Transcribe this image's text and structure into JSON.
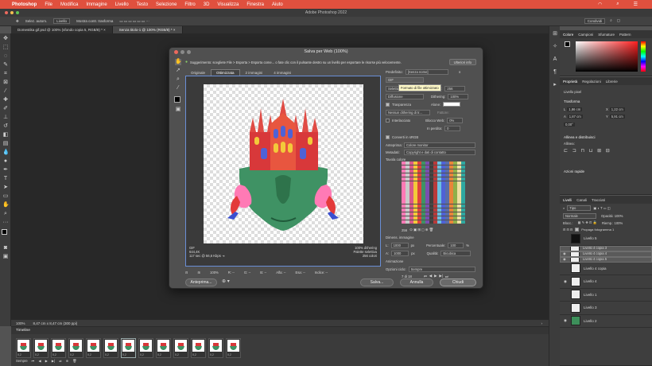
{
  "menubar": {
    "app": "Photoshop",
    "items": [
      "File",
      "Modifica",
      "Immagine",
      "Livello",
      "Testo",
      "Selezione",
      "Filtro",
      "3D",
      "Visualizza",
      "Finestra",
      "Aiuto"
    ]
  },
  "window": {
    "title": "Adobe Photoshop 2022"
  },
  "options": {
    "seleziona": "Selez. autom.",
    "livello": "Livello",
    "mostra": "Mostra contr. trasforma",
    "right_button": "Condividi"
  },
  "doc_tabs": [
    {
      "label": "Domestika gif.psd @ 100% (sfondo copia 5, RGB/8) *"
    },
    {
      "label": "Senza titolo-1 @ 100% (RGB/8) *"
    }
  ],
  "doc_status": {
    "zoom": "100%",
    "size": "8,47 cm x 8,47 cm (300 ppi)"
  },
  "timeline": {
    "title": "Timeline",
    "frames": [
      "0,2",
      "0,2",
      "0,2",
      "0,2",
      "0,2",
      "0,2",
      "0,2",
      "0,2",
      "0,2",
      "0,2",
      "0,2",
      "0,2",
      "0,2"
    ],
    "loop": "Sempre"
  },
  "panels": {
    "color_tabs": [
      "Colore",
      "Campioni",
      "Sfumature",
      "Pattern"
    ],
    "props_tabs": [
      "Proprietà",
      "Regolazioni",
      "Librerie"
    ],
    "props": {
      "type": "Livello pixel",
      "section": "Trasforma",
      "l": "L",
      "l_val": "1,86 cm",
      "h": "A",
      "h_val": "1,87 cm",
      "x": "X",
      "x_val": "1,22 cm",
      "y": "Y",
      "y_val": "5,91 cm",
      "angle": "0,00°",
      "align": "Allinea e distribuisci",
      "align_sub": "Allinea:",
      "quick": "Azioni rapide"
    },
    "layers_tabs": [
      "Livelli",
      "Canali",
      "Tracciati"
    ],
    "layers_filter": "Tipo",
    "layers_blend": "Normale",
    "layers_opacity": "Opacità: 100%",
    "layers_lock": "Blocc.:",
    "layers_fill": "Riemp.: 100%",
    "layers_unify": "Propaga fotogramma 1",
    "layers": [
      {
        "name": "Livello 5",
        "visible": false,
        "selected": false,
        "thumb": "#111111"
      },
      {
        "name": "Livello 4 copia 3",
        "visible": false,
        "selected": true,
        "thumb": "#eeeeee"
      },
      {
        "name": "Livello 4 copia 4",
        "visible": true,
        "selected": true,
        "thumb": "#eeeeee"
      },
      {
        "name": "Livello 4 copia 5",
        "visible": true,
        "selected": true,
        "thumb": "#eeeeee"
      },
      {
        "name": "Livello 4 copia",
        "visible": false,
        "selected": false,
        "thumb": "#eeeeee"
      },
      {
        "name": "Livello 4",
        "visible": true,
        "selected": false,
        "thumb": "#eeeeee"
      },
      {
        "name": "Livello 1",
        "visible": false,
        "selected": false,
        "thumb": "#eeeeee"
      },
      {
        "name": "Livello 3",
        "visible": false,
        "selected": false,
        "thumb": "#eeeeee"
      },
      {
        "name": "Livello 2",
        "visible": true,
        "selected": false,
        "thumb": "#3d8f5a"
      }
    ]
  },
  "dialog": {
    "title": "Salva per Web (100%)",
    "hint": "Suggerimento: scegliete File > Esporta > Esporta come... o fate clic con il pulsante destro su un livello per esportare le risorse più velocemente.",
    "hint_button": "Ulteriori info",
    "view_tabs": [
      "Originale",
      "Ottimizzata",
      "2 immagini",
      "4 immagini"
    ],
    "preview_left": [
      "GIF",
      "644,4K",
      "117 sec @ 56,6 Kbps"
    ],
    "preview_right": [
      "100% dithering",
      "Palette selettiva",
      "256 colori"
    ],
    "zoom": "100%",
    "r": "R: --",
    "g": "G: --",
    "b": "B: --",
    "alpha": "Alfa: --",
    "hex": "Esa: --",
    "index": "Indice: --",
    "preview_btn": "Anteprima...",
    "save_btn": "Salva...",
    "cancel_btn": "Annulla",
    "close_btn": "Chiudi",
    "settings": {
      "preset_label": "Predefinito:",
      "preset": "[Senza nome]",
      "format": "GIF",
      "tooltip": "Formato di file ottimizzato",
      "reduction": "Selettiva",
      "colors_label": "Colori:",
      "colors": "256",
      "dither_algo": "Diffusione",
      "dither_label": "Dithering:",
      "dither": "100%",
      "transparency": "Trasparenza",
      "matte_label": "Alone:",
      "no_dither": "Nessun dithering di tr...",
      "amount_label": "Fattore:",
      "interlaced": "Interlacciato",
      "websnap_label": "Blocco Web:",
      "websnap": "0%",
      "lossy_label": "In perdita:",
      "lossy": "0",
      "convert_srgb": "Converti in sRGB",
      "preview_label": "Anteprima:",
      "preview": "Colore monitor",
      "metadata_label": "Metadati:",
      "metadata": "Copyright e dati di contatto",
      "color_table": "Tavola colore",
      "color_count": "256",
      "size_title": "Dimens. immagine",
      "w_label": "L:",
      "w": "1000",
      "h_label": "A:",
      "h": "1000",
      "px": "px",
      "pct_label": "Percentuale:",
      "pct": "100",
      "pct_unit": "%",
      "quality_label": "Qualità:",
      "quality": "Bicubica",
      "anim_title": "Animazione",
      "loop_label": "Opzioni ciclo:",
      "loop": "Sempre",
      "frame_counter": "7 di 18"
    }
  },
  "colors": {
    "accent": "#e0503e",
    "selection": "#6a8fd6"
  }
}
